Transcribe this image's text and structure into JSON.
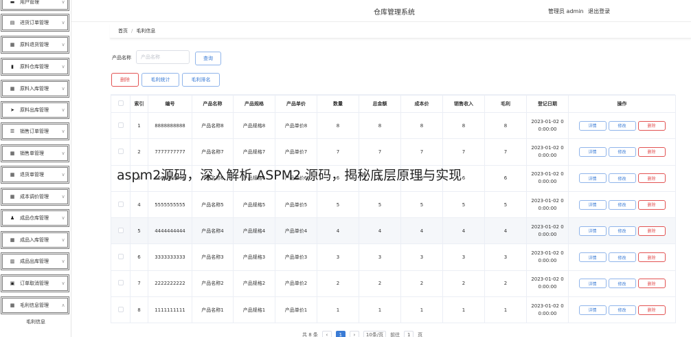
{
  "sidebar": {
    "items": [
      {
        "label": "用户管理",
        "icon": "user-icon",
        "glyph": "▬",
        "arrow": "∨"
      },
      {
        "label": "进货订单管理",
        "icon": "clipboard-icon",
        "glyph": "▤",
        "arrow": "∨"
      },
      {
        "label": "原料退货管理",
        "icon": "grid-icon",
        "glyph": "▦",
        "arrow": "∨"
      },
      {
        "label": "原料仓库管理",
        "icon": "bar-chart-icon",
        "glyph": "▮",
        "arrow": "∨"
      },
      {
        "label": "原料入库管理",
        "icon": "grid-icon",
        "glyph": "▦",
        "arrow": "∨"
      },
      {
        "label": "原料出库管理",
        "icon": "send-icon",
        "glyph": "➤",
        "arrow": "∨"
      },
      {
        "label": "销售订单管理",
        "icon": "list-icon",
        "glyph": "☰",
        "arrow": "∨"
      },
      {
        "label": "销售单管理",
        "icon": "grid-icon",
        "glyph": "▦",
        "arrow": "∨"
      },
      {
        "label": "退货单管理",
        "icon": "grid-icon",
        "glyph": "▦",
        "arrow": "∨"
      },
      {
        "label": "成本调价管理",
        "icon": "grid-icon",
        "glyph": "▦",
        "arrow": "∨"
      },
      {
        "label": "成品仓库管理",
        "icon": "person-icon",
        "glyph": "♟",
        "arrow": "∨"
      },
      {
        "label": "成品入库管理",
        "icon": "grid-icon",
        "glyph": "▦",
        "arrow": "∨"
      },
      {
        "label": "成品出库管理",
        "icon": "column-chart-icon",
        "glyph": "▥",
        "arrow": "∨"
      },
      {
        "label": "订单取消管理",
        "icon": "trash-icon",
        "glyph": "▣",
        "arrow": "∨"
      },
      {
        "label": "毛利信息管理",
        "icon": "grid-icon",
        "glyph": "▦",
        "arrow": "∧"
      }
    ],
    "sub_item": "毛利信息"
  },
  "header": {
    "title": "仓库管理系统",
    "user": "管理员 admin",
    "logout": "退出登录"
  },
  "breadcrumb": {
    "home": "首页",
    "sep": "/",
    "current": "毛利信息"
  },
  "search": {
    "label": "产品名称",
    "placeholder": "产品名称",
    "button": "查询"
  },
  "toolbar": {
    "delete": "删除",
    "stats": "毛利统计",
    "ranking": "毛利排名"
  },
  "table": {
    "headers": [
      "",
      "索引",
      "编号",
      "产品名称",
      "产品规格",
      "产品单价",
      "数量",
      "总金额",
      "成本价",
      "销售收入",
      "毛利",
      "登记日期",
      "操作"
    ],
    "ops": {
      "detail": "详情",
      "edit": "修改",
      "delete": "删除"
    },
    "rows": [
      {
        "index": "1",
        "code": "8888888888",
        "name": "产品名称8",
        "spec": "产品规格8",
        "price": "产品单价8",
        "qty": "8",
        "total": "8",
        "cost": "8",
        "revenue": "8",
        "profit": "8",
        "date1": "2023-01-02 0",
        "date2": "0:00:00"
      },
      {
        "index": "2",
        "code": "7777777777",
        "name": "产品名称7",
        "spec": "产品规格7",
        "price": "产品单价7",
        "qty": "7",
        "total": "7",
        "cost": "7",
        "revenue": "7",
        "profit": "7",
        "date1": "2023-01-02 0",
        "date2": "0:00:00"
      },
      {
        "index": "3",
        "code": "6666666666",
        "name": "产品名称6",
        "spec": "产品规格6",
        "price": "产品单价6",
        "qty": "6",
        "total": "6",
        "cost": "6",
        "revenue": "6",
        "profit": "6",
        "date1": "2023-01-02 0",
        "date2": "0:00:00"
      },
      {
        "index": "4",
        "code": "5555555555",
        "name": "产品名称5",
        "spec": "产品规格5",
        "price": "产品单价5",
        "qty": "5",
        "total": "5",
        "cost": "5",
        "revenue": "5",
        "profit": "5",
        "date1": "2023-01-02 0",
        "date2": "0:00:00"
      },
      {
        "index": "5",
        "code": "4444444444",
        "name": "产品名称4",
        "spec": "产品规格4",
        "price": "产品单价4",
        "qty": "4",
        "total": "4",
        "cost": "4",
        "revenue": "4",
        "profit": "4",
        "date1": "2023-01-02 0",
        "date2": "0:00:00"
      },
      {
        "index": "6",
        "code": "3333333333",
        "name": "产品名称3",
        "spec": "产品规格3",
        "price": "产品单价3",
        "qty": "3",
        "total": "3",
        "cost": "3",
        "revenue": "3",
        "profit": "3",
        "date1": "2023-01-02 0",
        "date2": "0:00:00"
      },
      {
        "index": "7",
        "code": "2222222222",
        "name": "产品名称2",
        "spec": "产品规格2",
        "price": "产品单价2",
        "qty": "2",
        "total": "2",
        "cost": "2",
        "revenue": "2",
        "profit": "2",
        "date1": "2023-01-02 0",
        "date2": "0:00:00"
      },
      {
        "index": "8",
        "code": "1111111111",
        "name": "产品名称1",
        "spec": "产品规格1",
        "price": "产品单价1",
        "qty": "1",
        "total": "1",
        "cost": "1",
        "revenue": "1",
        "profit": "1",
        "date1": "2023-01-02 0",
        "date2": "0:00:00"
      }
    ]
  },
  "pagination": {
    "total": "共 8 条",
    "current_page": "1",
    "page_size": "10条/页",
    "goto_label": "前往",
    "goto_value": "1",
    "goto_suffix": "页"
  },
  "watermark": "aspm2源码，深入解析 ASPM2 源码，揭秘底层原理与实现",
  "colors": {
    "accent": "#3a7bd5",
    "danger": "#e25252",
    "border": "#ebeef5",
    "highlight_row": "#f5f7fa"
  }
}
